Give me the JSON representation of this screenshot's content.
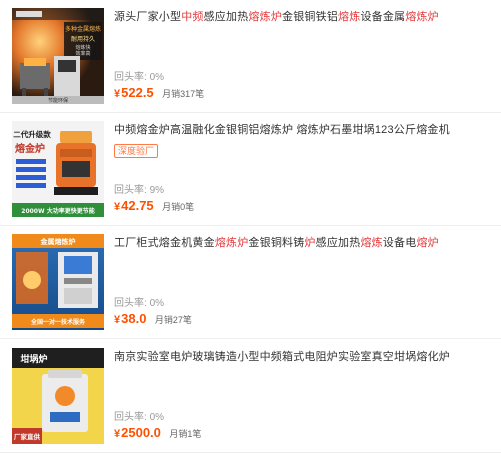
{
  "colors": {
    "accent": "#ff5000",
    "highlight": "#e4393c",
    "tag": "#ff7a45",
    "muted": "#999999",
    "divider": "#eeeeee"
  },
  "items": [
    {
      "title_parts": [
        {
          "text": "源头厂家小型",
          "hl": false
        },
        {
          "text": "中频",
          "hl": true
        },
        {
          "text": "感应加热",
          "hl": false
        },
        {
          "text": "熔炼炉",
          "hl": true
        },
        {
          "text": "金银铜铁铝",
          "hl": false
        },
        {
          "text": "熔炼",
          "hl": true
        },
        {
          "text": "设备金属",
          "hl": false
        },
        {
          "text": "熔炼炉",
          "hl": true
        }
      ],
      "tag": "",
      "repurchase_label": "回头率:",
      "repurchase_value": "0%",
      "currency": "¥",
      "price": "522.5",
      "sold_text": "月销317笔",
      "thumb_texts": [
        "多种金属熔炼",
        "耐用持久",
        "熔炼快",
        "效率高",
        "节能环保"
      ],
      "thumb_icon": "furnace-image"
    },
    {
      "title_parts": [
        {
          "text": "中频熔金炉高温融化金银铜铝熔炼炉 熔炼炉石墨坩埚123公斤熔金机",
          "hl": false
        }
      ],
      "tag": "深度验厂",
      "repurchase_label": "回头率:",
      "repurchase_value": "9%",
      "currency": "¥",
      "price": "42.75",
      "sold_text": "月销0笔",
      "thumb_texts": [
        "二代升级款",
        "熔金炉",
        "2000W 大功率更快更节能"
      ],
      "thumb_icon": "gold-melting-furnace-image"
    },
    {
      "title_parts": [
        {
          "text": "工厂柜式熔金机黄金",
          "hl": false
        },
        {
          "text": "熔炼炉",
          "hl": true
        },
        {
          "text": "金银铜料铸",
          "hl": false
        },
        {
          "text": "炉",
          "hl": true
        },
        {
          "text": "感应加热",
          "hl": false
        },
        {
          "text": "熔炼",
          "hl": true
        },
        {
          "text": "设备电",
          "hl": false
        },
        {
          "text": "熔炉",
          "hl": true
        }
      ],
      "tag": "",
      "repurchase_label": "回头率:",
      "repurchase_value": "0%",
      "currency": "¥",
      "price": "38.0",
      "sold_text": "月销27笔",
      "thumb_texts": [
        "金属熔炼炉",
        "全国一对一技术服务"
      ],
      "thumb_icon": "cabinet-furnace-image"
    },
    {
      "title_parts": [
        {
          "text": "南京实验室电炉玻璃铸造小型中频箱式电阻炉实验室真空坩埚熔化炉",
          "hl": false
        }
      ],
      "tag": "",
      "repurchase_label": "回头率:",
      "repurchase_value": "0%",
      "currency": "¥",
      "price": "2500.0",
      "sold_text": "月销1笔",
      "thumb_texts": [
        "坩埚炉",
        "厂家直供"
      ],
      "thumb_icon": "crucible-furnace-image"
    }
  ]
}
